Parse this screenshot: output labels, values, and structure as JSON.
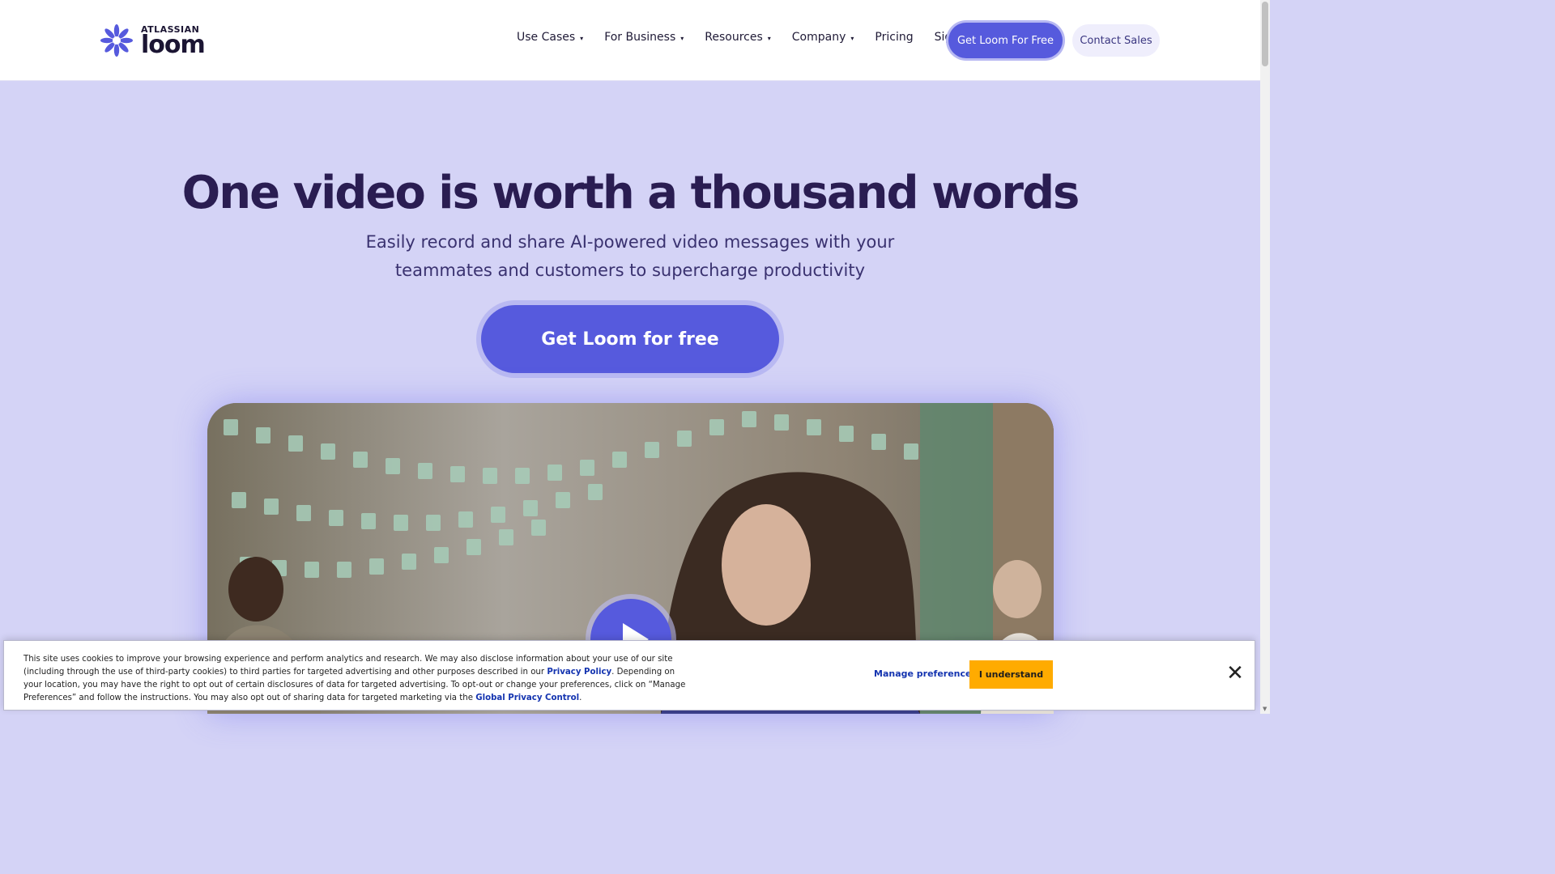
{
  "header": {
    "logo": {
      "brand": "ATLASSIAN",
      "product": "loom",
      "icon": "loom-starburst-icon",
      "color": "#565add"
    },
    "nav": [
      {
        "label": "Use Cases",
        "dropdown": true
      },
      {
        "label": "For Business",
        "dropdown": true
      },
      {
        "label": "Resources",
        "dropdown": true
      },
      {
        "label": "Company",
        "dropdown": true
      },
      {
        "label": "Pricing",
        "dropdown": false
      },
      {
        "label": "Sign In",
        "dropdown": false
      }
    ],
    "caret": "▾",
    "cta_primary": "Get Loom For Free",
    "cta_secondary": "Contact Sales"
  },
  "hero": {
    "title": "One video is worth a thousand words",
    "subtitle_line1": "Easily record and share AI-powered video messages with your",
    "subtitle_line2": "teammates and customers to supercharge productivity",
    "cta": "Get Loom for free",
    "accent": "#565add",
    "background": "#d4d3f6"
  },
  "video": {
    "play_icon": "play-icon"
  },
  "cookie_banner": {
    "text_part1": "This site uses cookies to improve your browsing experience and perform analytics and research. We may also disclose information about your use of our site (including through the use of third-party cookies) to third parties for targeted advertising and other purposes described in our ",
    "privacy_link": "Privacy Policy",
    "text_part2": ". Depending on your location, you may have the right to opt out of certain disclosures of data for targeted advertising. To opt-out or change your preferences, click on “Manage Preferences” and follow the instructions. You may also opt out of sharing data for targeted marketing via the ",
    "gpc_link": "Global Privacy Control",
    "text_part3": ".",
    "manage_label": "Manage preferences",
    "accept_label": "I understand",
    "close_icon": "close-icon",
    "accept_color": "#ffab00"
  }
}
